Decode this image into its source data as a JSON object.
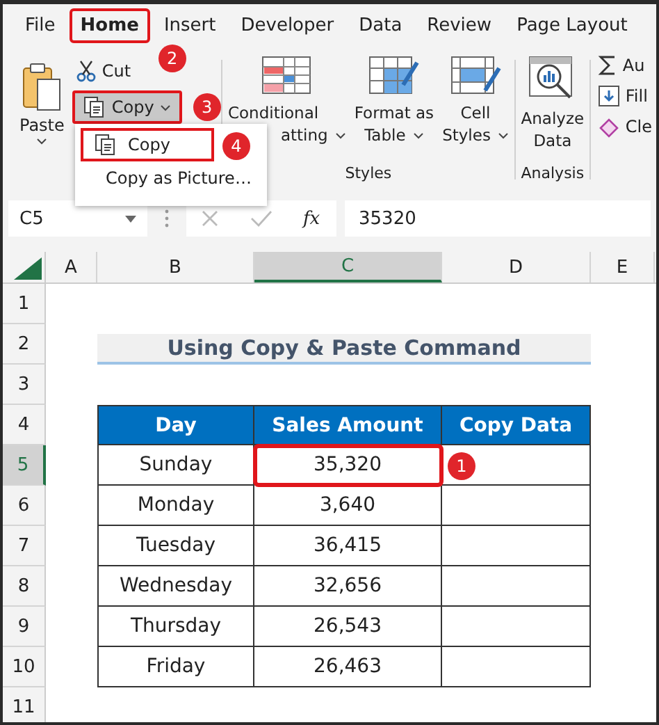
{
  "ribbon_tabs": [
    {
      "label": "File",
      "selected": false,
      "highlighted": false
    },
    {
      "label": "Home",
      "selected": true,
      "highlighted": true,
      "step": "2"
    },
    {
      "label": "Insert",
      "selected": false,
      "highlighted": false
    },
    {
      "label": "Developer",
      "selected": false,
      "highlighted": false
    },
    {
      "label": "Data",
      "selected": false,
      "highlighted": false
    },
    {
      "label": "Review",
      "selected": false,
      "highlighted": false
    },
    {
      "label": "Page Layout",
      "selected": false,
      "highlighted": false
    }
  ],
  "clipboard": {
    "paste": "Paste",
    "cut": "Cut",
    "copy": {
      "label": "Copy",
      "highlighted": true,
      "step": "3"
    }
  },
  "copy_menu": [
    {
      "label": "Copy",
      "highlighted": true,
      "step": "4"
    },
    {
      "label": "Copy as Picture…",
      "highlighted": false
    }
  ],
  "styles_group": {
    "label": "Styles",
    "buttons": [
      {
        "kind": "conditional",
        "lines": [
          "Conditional",
          "atting"
        ],
        "dropdown": true
      },
      {
        "kind": "table",
        "lines": [
          "Format as",
          "Table"
        ],
        "dropdown": true
      },
      {
        "kind": "cell_styles",
        "lines": [
          "Cell",
          "Styles"
        ],
        "dropdown": true
      }
    ]
  },
  "analysis_group": {
    "label": "Analysis",
    "buttons": [
      {
        "kind": "analyze",
        "lines": [
          "Analyze",
          "Data"
        ]
      }
    ]
  },
  "editing_group": {
    "buttons": [
      {
        "kind": "sum",
        "label": "Au"
      },
      {
        "kind": "fill",
        "label": "Fill"
      },
      {
        "kind": "clear",
        "label": "Cle"
      }
    ]
  },
  "formula_bar": {
    "name_box": "C5",
    "function_label": "fx",
    "value": "35320"
  },
  "columns": [
    {
      "label": "A",
      "selected": false
    },
    {
      "label": "B",
      "selected": false
    },
    {
      "label": "C",
      "selected": true
    },
    {
      "label": "D",
      "selected": false
    },
    {
      "label": "E",
      "selected": false
    }
  ],
  "rows": [
    {
      "label": "1",
      "selected": false
    },
    {
      "label": "2",
      "selected": false
    },
    {
      "label": "3",
      "selected": false
    },
    {
      "label": "4",
      "selected": false
    },
    {
      "label": "5",
      "selected": true
    },
    {
      "label": "6",
      "selected": false
    },
    {
      "label": "7",
      "selected": false
    },
    {
      "label": "8",
      "selected": false
    },
    {
      "label": "9",
      "selected": false
    },
    {
      "label": "10",
      "selected": false
    },
    {
      "label": "11",
      "selected": false
    }
  ],
  "sheet_table": {
    "title": "Using Copy & Paste Command",
    "headers": [
      "Day",
      "Sales Amount",
      "Copy Data"
    ],
    "rows": [
      {
        "day": "Sunday",
        "amount": "35,320",
        "highlighted": true,
        "step": "1"
      },
      {
        "day": "Monday",
        "amount": "3,640",
        "highlighted": false
      },
      {
        "day": "Tuesday",
        "amount": "36,415",
        "highlighted": false
      },
      {
        "day": "Wednesday",
        "amount": "32,656",
        "highlighted": false
      },
      {
        "day": "Thursday",
        "amount": "26,543",
        "highlighted": false
      },
      {
        "day": "Friday",
        "amount": "26,463",
        "highlighted": false
      }
    ]
  }
}
